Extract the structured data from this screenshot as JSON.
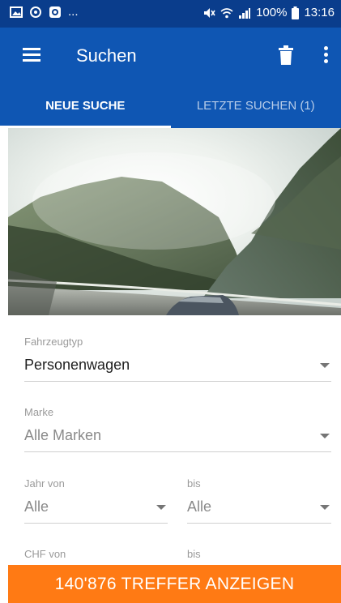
{
  "statusbar": {
    "dots": "...",
    "battery": "100%",
    "time": "13:16",
    "icons": [
      "image-icon",
      "at-icon",
      "cast-icon",
      "mute-icon",
      "wifi-icon",
      "signal-icon",
      "battery-icon"
    ]
  },
  "appbar": {
    "title": "Suchen",
    "icons": [
      "menu-icon",
      "trash-icon",
      "more-vert-icon"
    ]
  },
  "tabs": [
    {
      "label": "NEUE SUCHE",
      "active": true
    },
    {
      "label": "LETZTE SUCHEN (1)",
      "active": false
    }
  ],
  "form": {
    "fahrzeugtyp": {
      "label": "Fahrzeugtyp",
      "value": "Personenwagen"
    },
    "marke": {
      "label": "Marke",
      "value": "Alle Marken"
    },
    "jahr_von": {
      "label": "Jahr von",
      "value": "Alle"
    },
    "jahr_bis": {
      "label": "bis",
      "value": "Alle"
    },
    "chf_von": {
      "label": "CHF von"
    },
    "chf_bis": {
      "label": "bis"
    }
  },
  "cta": {
    "label": "140'876 TREFFER ANZEIGEN"
  },
  "colors": {
    "statusbar": "#0a3d8c",
    "primary": "#0f56b3",
    "accent": "#ff7a14"
  }
}
